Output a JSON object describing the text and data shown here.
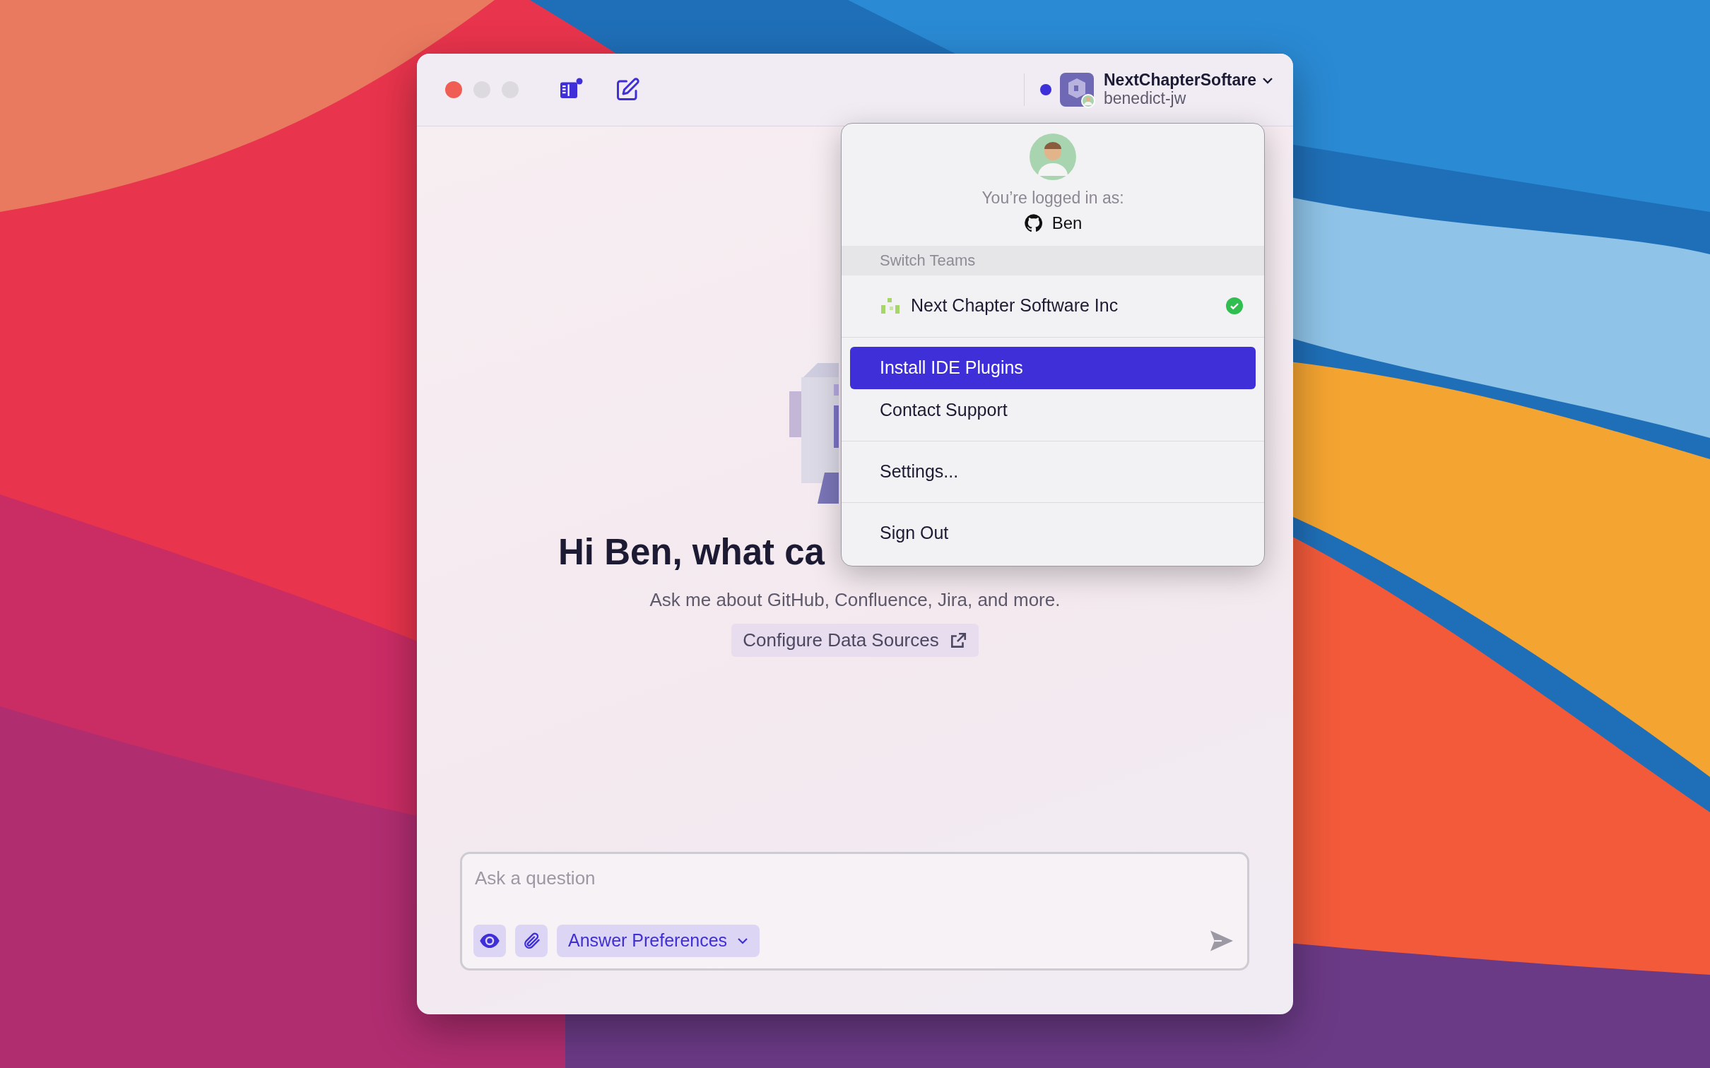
{
  "titlebar": {
    "team": "NextChapterSoftare",
    "user": "benedict-jw"
  },
  "menu": {
    "logged_in_label": "You’re logged in as:",
    "user": "Ben",
    "section_header": "Switch Teams",
    "teams": [
      {
        "name": "Next Chapter Software Inc",
        "selected": true
      }
    ],
    "groups": [
      {
        "items": [
          {
            "label": "Install IDE Plugins",
            "highlighted": true
          },
          {
            "label": "Contact Support",
            "highlighted": false
          }
        ]
      },
      {
        "items": [
          {
            "label": "Settings...",
            "highlighted": false
          }
        ]
      },
      {
        "items": [
          {
            "label": "Sign Out",
            "highlighted": false
          }
        ]
      }
    ]
  },
  "hero": {
    "heading": "Hi Ben, what ca",
    "subtitle": "Ask me about GitHub, Confluence, Jira, and more.",
    "link": "Configure Data Sources"
  },
  "composer": {
    "placeholder": "Ask a question",
    "preferences": "Answer Preferences"
  }
}
